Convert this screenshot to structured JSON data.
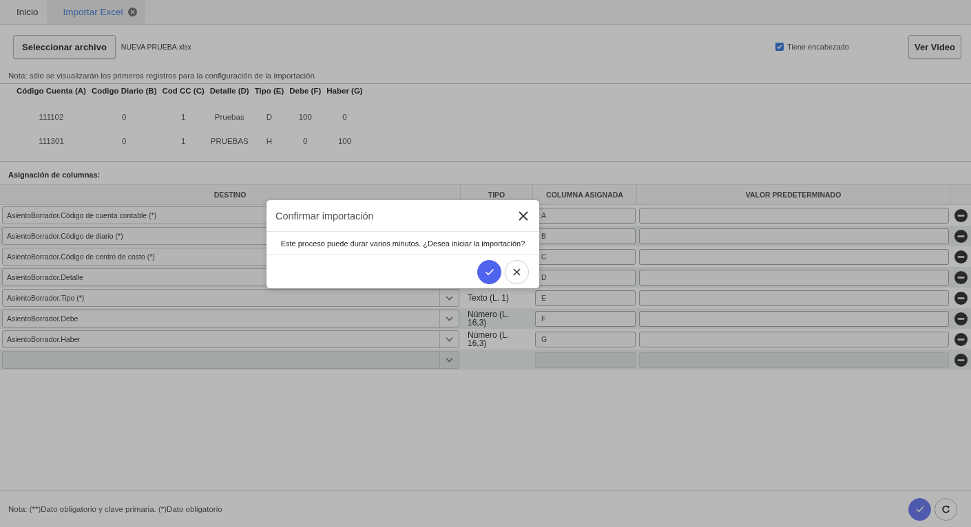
{
  "tabs": [
    {
      "label": "Inicio",
      "selected": false,
      "closable": false
    },
    {
      "label": "Importar Excel",
      "selected": true,
      "closable": true
    }
  ],
  "file": {
    "button": "Seleccionar archivo",
    "name": "NUEVA PRUEBA.xlsx"
  },
  "header_option": {
    "label": "Tiene encabezado",
    "checked": true
  },
  "video_button": "Ver Video",
  "note": "Nota: sólo se visualizarán los primeros registros para la configuración de la importación",
  "preview": {
    "columns": [
      "Código Cuenta (A)",
      "Codigo Diario (B)",
      "Cod CC (C)",
      "Detalle (D)",
      "Tipo (E)",
      "Debe (F)",
      "Haber (G)"
    ],
    "rows": [
      [
        "111102",
        "0",
        "1",
        "Pruebas",
        "D",
        "100",
        "0"
      ],
      [
        "111301",
        "0",
        "1",
        "PRUEBAS",
        "H",
        "0",
        "100"
      ]
    ]
  },
  "mapping_title": "Asignación de columnas:",
  "mapping": {
    "columns": [
      "DESTINO",
      "TIPO",
      "COLUMNA ASIGNADA",
      "VALOR PREDETERMINADO"
    ],
    "rows": [
      {
        "destino": "AsientoBorrador.Código de cuenta contable (*)",
        "columna": "A",
        "disabled": false
      },
      {
        "destino": "AsientoBorrador.Código de diario (*)",
        "columna": "B",
        "disabled": false
      },
      {
        "destino": "AsientoBorrador.Código de centro de costo (*)",
        "columna": "C",
        "disabled": false
      },
      {
        "destino": "AsientoBorrador.Detalle",
        "columna": "D",
        "disabled": false
      },
      {
        "destino": "AsientoBorrador.Tipo (*)",
        "tipo": "Texto (L. 1)",
        "columna": "E",
        "disabled": false
      },
      {
        "destino": "AsientoBorrador.Debe",
        "tipo": "Número (L. 16,3)",
        "columna": "F",
        "disabled": false
      },
      {
        "destino": "AsientoBorrador.Haber",
        "tipo": "Número (L. 16,3)",
        "columna": "G",
        "disabled": false
      },
      {
        "disabled": true
      }
    ]
  },
  "footer_note": "Nota: (**)Dato obligatorio y clave primaria. (*)Dato obligatorio",
  "dialog": {
    "title": "Confirmar importación",
    "message": "Este proceso puede durar varios minutos. ¿Desea iniciar la importación?"
  }
}
